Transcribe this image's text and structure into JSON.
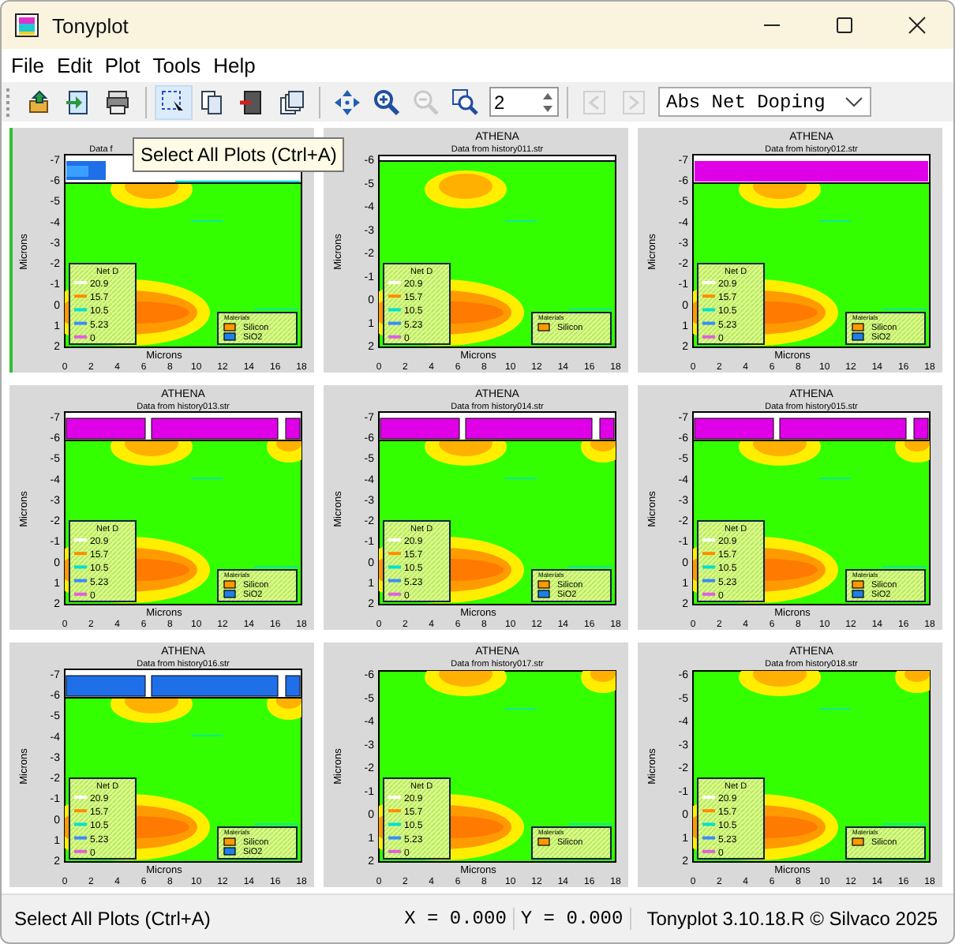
{
  "window": {
    "title": "Tonyplot"
  },
  "menu": [
    "File",
    "Edit",
    "Plot",
    "Tools",
    "Help"
  ],
  "toolbar": {
    "groups": [
      [
        {
          "kind": "open",
          "disabled": false,
          "selected": false
        },
        {
          "kind": "import",
          "disabled": false,
          "selected": false
        },
        {
          "kind": "print",
          "disabled": false,
          "selected": false
        }
      ],
      [
        {
          "kind": "select",
          "disabled": false,
          "selected": true
        },
        {
          "kind": "copy",
          "disabled": false,
          "selected": false
        },
        {
          "kind": "delete",
          "disabled": false,
          "selected": false
        },
        {
          "kind": "stack",
          "disabled": false,
          "selected": false
        }
      ],
      [
        {
          "kind": "move",
          "disabled": false,
          "selected": false
        },
        {
          "kind": "zoom-in",
          "disabled": false,
          "selected": false
        },
        {
          "kind": "zoom-out",
          "disabled": true,
          "selected": false
        },
        {
          "kind": "zoom-box",
          "disabled": false,
          "selected": false
        },
        {
          "kind": "spin",
          "value": "2"
        }
      ],
      [
        {
          "kind": "prev",
          "disabled": true,
          "selected": false
        },
        {
          "kind": "next",
          "disabled": true,
          "selected": false
        },
        {
          "kind": "dropdown",
          "value": "Abs Net Doping"
        }
      ]
    ]
  },
  "tooltip": "Select All Plots (Ctrl+A)",
  "plots": [
    {
      "selected": true,
      "subtitle": "Data f",
      "top_layer": {
        "kind": "partial",
        "color": "#1e6fe8"
      },
      "y_ticks": [
        "-7",
        "-6",
        "-5",
        "-4",
        "-3",
        "-2",
        "-1",
        "0",
        "1",
        "2"
      ],
      "x_ticks": [
        "0",
        "2",
        "4",
        "6",
        "8",
        "10",
        "12",
        "14",
        "16",
        "18"
      ],
      "axis_labels": [
        "Microns",
        "Microns"
      ],
      "legend_title": "Net D",
      "legend": [
        {
          "value": "20.9",
          "color": "#ffffff"
        },
        {
          "value": "15.7",
          "color": "#ff8c00"
        },
        {
          "value": "10.5",
          "color": "#00e0d0"
        },
        {
          "value": "5.23",
          "color": "#3a8cff"
        },
        {
          "value": "0",
          "color": "#e060e0"
        }
      ],
      "materials_title": "Materials",
      "materials": [
        {
          "name": "Silicon",
          "color": "#ff9900"
        },
        {
          "name": "SiO2",
          "color": "#1e7fe8"
        }
      ]
    },
    {
      "selected": false,
      "title": "ATHENA",
      "subtitle": "Data from history011.str",
      "top_layer": {
        "kind": "line",
        "color": "#ffffff"
      },
      "y_ticks": [
        "-6",
        "-5",
        "-4",
        "-3",
        "-2",
        "-1",
        "0",
        "1",
        "2"
      ],
      "x_ticks": [
        "0",
        "2",
        "4",
        "6",
        "8",
        "10",
        "12",
        "14",
        "16",
        "18"
      ],
      "axis_labels": [
        "Microns",
        "Microns"
      ],
      "legend_title": "Net D",
      "legend": [
        {
          "value": "20.9",
          "color": "#ffffff"
        },
        {
          "value": "15.7",
          "color": "#ff8c00"
        },
        {
          "value": "10.5",
          "color": "#00e0d0"
        },
        {
          "value": "5.23",
          "color": "#3a8cff"
        },
        {
          "value": "0",
          "color": "#e060e0"
        }
      ],
      "materials_title": "Materials",
      "materials": [
        {
          "name": "Silicon",
          "color": "#ff9900"
        }
      ]
    },
    {
      "selected": false,
      "title": "ATHENA",
      "subtitle": "Data from history012.str",
      "top_layer": {
        "kind": "full",
        "color": "#e000e8"
      },
      "y_ticks": [
        "-7",
        "-6",
        "-5",
        "-4",
        "-3",
        "-2",
        "-1",
        "0",
        "1",
        "2"
      ],
      "x_ticks": [
        "0",
        "2",
        "4",
        "6",
        "8",
        "10",
        "12",
        "14",
        "16",
        "18"
      ],
      "axis_labels": [
        "Microns",
        "Microns"
      ],
      "legend_title": "Net D",
      "legend": [
        {
          "value": "20.9",
          "color": "#ffffff"
        },
        {
          "value": "15.7",
          "color": "#ff8c00"
        },
        {
          "value": "10.5",
          "color": "#00e0d0"
        },
        {
          "value": "5.23",
          "color": "#3a8cff"
        },
        {
          "value": "0",
          "color": "#e060e0"
        }
      ],
      "materials_title": "Materials",
      "materials": [
        {
          "name": "Silicon",
          "color": "#ff9900"
        },
        {
          "name": "SiO2",
          "color": "#1e7fe8"
        }
      ]
    },
    {
      "selected": false,
      "title": "ATHENA",
      "subtitle": "Data from history013.str",
      "top_layer": {
        "kind": "gapped",
        "color": "#e000e8"
      },
      "y_ticks": [
        "-7",
        "-6",
        "-5",
        "-4",
        "-3",
        "-2",
        "-1",
        "0",
        "1",
        "2"
      ],
      "x_ticks": [
        "0",
        "2",
        "4",
        "6",
        "8",
        "10",
        "12",
        "14",
        "16",
        "18"
      ],
      "axis_labels": [
        "Microns",
        "Microns"
      ],
      "legend_title": "Net D",
      "legend": [
        {
          "value": "20.9",
          "color": "#ffffff"
        },
        {
          "value": "15.7",
          "color": "#ff8c00"
        },
        {
          "value": "10.5",
          "color": "#00e0d0"
        },
        {
          "value": "5.23",
          "color": "#3a8cff"
        },
        {
          "value": "0",
          "color": "#e060e0"
        }
      ],
      "materials_title": "Materials",
      "materials": [
        {
          "name": "Silicon",
          "color": "#ff9900"
        },
        {
          "name": "SiO2",
          "color": "#1e7fe8"
        }
      ]
    },
    {
      "selected": false,
      "title": "ATHENA",
      "subtitle": "Data from history014.str",
      "top_layer": {
        "kind": "gapped",
        "color": "#e000e8"
      },
      "y_ticks": [
        "-7",
        "-6",
        "-5",
        "-4",
        "-3",
        "-2",
        "-1",
        "0",
        "1",
        "2"
      ],
      "x_ticks": [
        "0",
        "2",
        "4",
        "6",
        "8",
        "10",
        "12",
        "14",
        "16",
        "18"
      ],
      "axis_labels": [
        "Microns",
        "Microns"
      ],
      "legend_title": "Net D",
      "legend": [
        {
          "value": "20.9",
          "color": "#ffffff"
        },
        {
          "value": "15.7",
          "color": "#ff8c00"
        },
        {
          "value": "10.5",
          "color": "#00e0d0"
        },
        {
          "value": "5.23",
          "color": "#3a8cff"
        },
        {
          "value": "0",
          "color": "#e060e0"
        }
      ],
      "materials_title": "Materials",
      "materials": [
        {
          "name": "Silicon",
          "color": "#ff9900"
        },
        {
          "name": "SiO2",
          "color": "#1e7fe8"
        }
      ]
    },
    {
      "selected": false,
      "title": "ATHENA",
      "subtitle": "Data from history015.str",
      "top_layer": {
        "kind": "gapped",
        "color": "#e000e8"
      },
      "y_ticks": [
        "-7",
        "-6",
        "-5",
        "-4",
        "-3",
        "-2",
        "-1",
        "0",
        "1",
        "2"
      ],
      "x_ticks": [
        "0",
        "2",
        "4",
        "6",
        "8",
        "10",
        "12",
        "14",
        "16",
        "18"
      ],
      "axis_labels": [
        "Microns",
        "Microns"
      ],
      "legend_title": "Net D",
      "legend": [
        {
          "value": "20.9",
          "color": "#ffffff"
        },
        {
          "value": "15.7",
          "color": "#ff8c00"
        },
        {
          "value": "10.5",
          "color": "#00e0d0"
        },
        {
          "value": "5.23",
          "color": "#3a8cff"
        },
        {
          "value": "0",
          "color": "#e060e0"
        }
      ],
      "materials_title": "Materials",
      "materials": [
        {
          "name": "Silicon",
          "color": "#ff9900"
        },
        {
          "name": "SiO2",
          "color": "#1e7fe8"
        }
      ]
    },
    {
      "selected": false,
      "title": "ATHENA",
      "subtitle": "Data from history016.str",
      "top_layer": {
        "kind": "gapped",
        "color": "#1e6fe8"
      },
      "y_ticks": [
        "-7",
        "-6",
        "-5",
        "-4",
        "-3",
        "-2",
        "-1",
        "0",
        "1",
        "2"
      ],
      "x_ticks": [
        "0",
        "2",
        "4",
        "6",
        "8",
        "10",
        "12",
        "14",
        "16",
        "18"
      ],
      "axis_labels": [
        "Microns",
        "Microns"
      ],
      "legend_title": "Net D",
      "legend": [
        {
          "value": "20.9",
          "color": "#ffffff"
        },
        {
          "value": "15.7",
          "color": "#ff8c00"
        },
        {
          "value": "10.5",
          "color": "#00e0d0"
        },
        {
          "value": "5.23",
          "color": "#3a8cff"
        },
        {
          "value": "0",
          "color": "#e060e0"
        }
      ],
      "materials_title": "Materials",
      "materials": [
        {
          "name": "Silicon",
          "color": "#ff9900"
        },
        {
          "name": "SiO2",
          "color": "#1e7fe8"
        }
      ]
    },
    {
      "selected": false,
      "title": "ATHENA",
      "subtitle": "Data from history017.str",
      "top_layer": {
        "kind": "none"
      },
      "y_ticks": [
        "-6",
        "-5",
        "-4",
        "-3",
        "-2",
        "-1",
        "0",
        "1",
        "2"
      ],
      "x_ticks": [
        "0",
        "2",
        "4",
        "6",
        "8",
        "10",
        "12",
        "14",
        "16",
        "18"
      ],
      "axis_labels": [
        "Microns",
        "Microns"
      ],
      "legend_title": "Net D",
      "legend": [
        {
          "value": "20.9",
          "color": "#ffffff"
        },
        {
          "value": "15.7",
          "color": "#ff8c00"
        },
        {
          "value": "10.5",
          "color": "#00e0d0"
        },
        {
          "value": "5.23",
          "color": "#3a8cff"
        },
        {
          "value": "0",
          "color": "#e060e0"
        }
      ],
      "materials_title": "Materials",
      "materials": [
        {
          "name": "Silicon",
          "color": "#ff9900"
        }
      ]
    },
    {
      "selected": false,
      "title": "ATHENA",
      "subtitle": "Data from history018.str",
      "top_layer": {
        "kind": "none"
      },
      "y_ticks": [
        "-6",
        "-5",
        "-4",
        "-3",
        "-2",
        "-1",
        "0",
        "1",
        "2"
      ],
      "x_ticks": [
        "0",
        "2",
        "4",
        "6",
        "8",
        "10",
        "12",
        "14",
        "16",
        "18"
      ],
      "axis_labels": [
        "Microns",
        "Microns"
      ],
      "legend_title": "Net D",
      "legend": [
        {
          "value": "20.9",
          "color": "#ffffff"
        },
        {
          "value": "15.7",
          "color": "#ff8c00"
        },
        {
          "value": "10.5",
          "color": "#00e0d0"
        },
        {
          "value": "5.23",
          "color": "#3a8cff"
        },
        {
          "value": "0",
          "color": "#e060e0"
        }
      ],
      "materials_title": "Materials",
      "materials": [
        {
          "name": "Silicon",
          "color": "#ff9900"
        }
      ]
    }
  ],
  "status_bar": {
    "message": "Select All Plots (Ctrl+A)",
    "x": "X = 0.000",
    "y": "Y = 0.000",
    "version": "Tonyplot 3.10.18.R © Silvaco 2025"
  }
}
